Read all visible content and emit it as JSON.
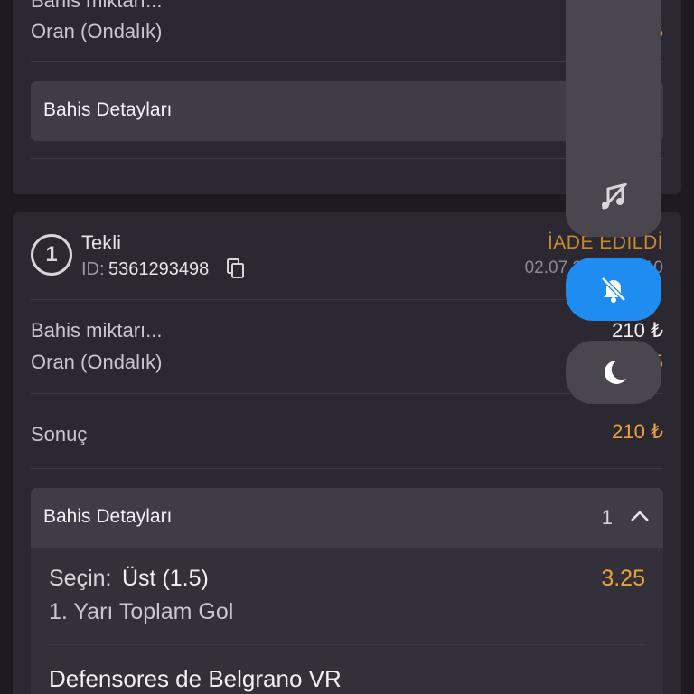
{
  "top_card": {
    "bet_amount_label": "Bahis miktarı...",
    "odds_label": "Oran (Ondalık)",
    "odds_value": "5",
    "details_title": "Bahis Detayları"
  },
  "ticket": {
    "number": "1",
    "type": "Tekli",
    "id_label": "ID:",
    "id": "5361293498",
    "status": "İADE EDİLDİ",
    "date": "02.07.2",
    "time_fragment": "10",
    "bet_amount_label": "Bahis miktarı...",
    "bet_amount_value": "210 ₺",
    "odds_label": "Oran (Ondalık)",
    "odds_value": "5",
    "result_label": "Sonuç",
    "result_value": "210 ₺",
    "details": {
      "title": "Bahis Detayları",
      "count": "1",
      "selection_prefix": "Seçin:",
      "selection": "Üst (1.5)",
      "selection_odds": "3.25",
      "market": "1. Yarı Toplam Gol",
      "event": "Defensores de Belgrano VR"
    }
  },
  "colors": {
    "accent_orange": "#e9a33a",
    "status_orange": "#c98a2e",
    "fab_blue": "#1e8cf0",
    "background": "#1d1a22",
    "card": "#2b2831"
  },
  "icons": [
    "copy-icon",
    "music-off-icon",
    "bell-off-icon",
    "moon-icon",
    "chevron-up-icon"
  ]
}
